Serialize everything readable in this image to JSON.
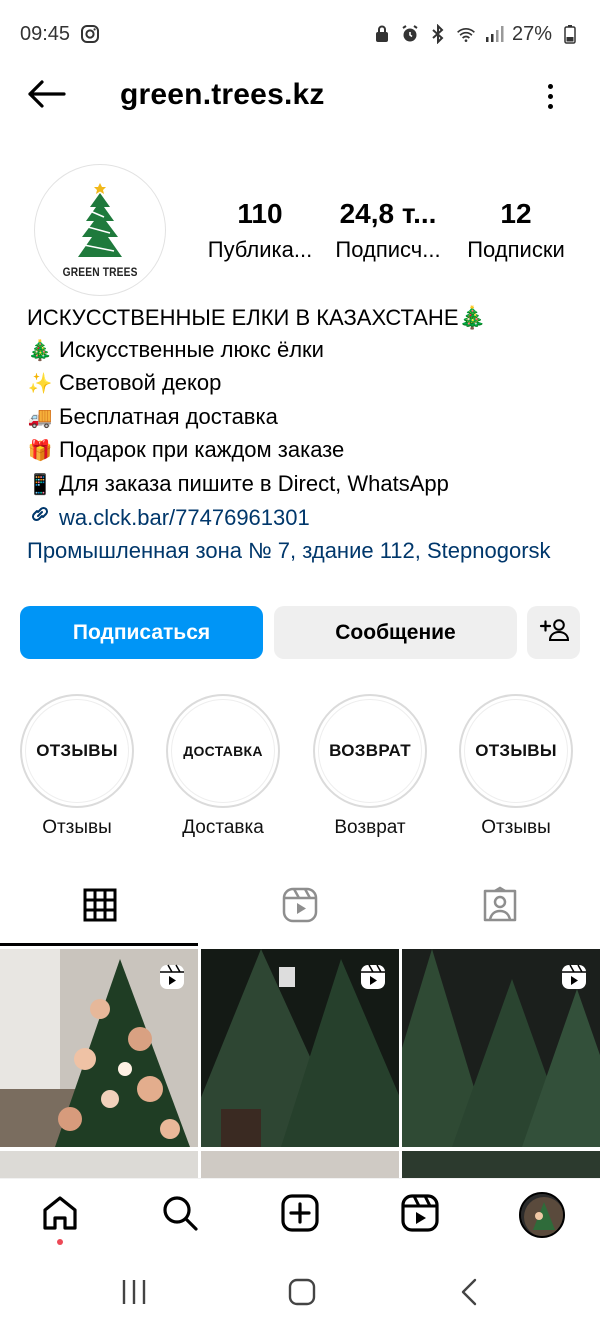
{
  "status_bar": {
    "time": "09:45",
    "battery": "27%",
    "icons": [
      "instagram-icon",
      "lock-icon",
      "alarm-icon",
      "bluetooth-icon",
      "wifi-icon",
      "signal-icon",
      "battery-icon"
    ]
  },
  "header": {
    "username": "green.trees.kz",
    "back_icon": "back-arrow-icon",
    "more_icon": "more-vertical-icon"
  },
  "profile": {
    "avatar_text": "GREEN TREES",
    "stats": [
      {
        "value": "110",
        "label": "Публика..."
      },
      {
        "value": "24,8 т...",
        "label": "Подписч..."
      },
      {
        "value": "12",
        "label": "Подписки"
      }
    ]
  },
  "bio": {
    "name": "ИСКУССТВЕННЫЕ ЕЛКИ В КАЗАХСТАНЕ🎄",
    "lines": [
      {
        "emoji": "🎄",
        "text": "Искусственные люкс ёлки"
      },
      {
        "emoji": "✨",
        "text": "Световой декор"
      },
      {
        "emoji": "🚚",
        "text": "Бесплатная доставка"
      },
      {
        "emoji": "🎁",
        "text": "Подарок при каждом заказе"
      },
      {
        "emoji": "📱",
        "text": "Для заказа пишите в Direct, WhatsApp"
      }
    ],
    "link": "wa.clck.bar/77476961301",
    "address": "Промышленная зона № 7, здание 112, Stepnogorsk"
  },
  "actions": {
    "follow": "Подписаться",
    "message": "Сообщение",
    "add_person_icon": "add-person-icon"
  },
  "highlights": [
    {
      "cover": "ОТЗЫВЫ",
      "label": "Отзывы"
    },
    {
      "cover": "ДОСТАВКА",
      "label": "Доставка"
    },
    {
      "cover": "ВОЗВРАТ",
      "label": "Возврат"
    },
    {
      "cover": "ОТЗЫВЫ",
      "label": "Отзывы"
    }
  ],
  "tabs": [
    "grid-icon",
    "reels-icon",
    "tagged-icon"
  ],
  "bottom_nav": [
    "home-icon",
    "search-icon",
    "create-icon",
    "reels-icon",
    "profile-avatar"
  ],
  "system_nav": [
    "recents-icon",
    "home-icon",
    "back-icon"
  ],
  "colors": {
    "accent": "#0095f6",
    "link": "#00376b",
    "secondary_button": "#efefef",
    "notification_dot": "#ed4956"
  }
}
